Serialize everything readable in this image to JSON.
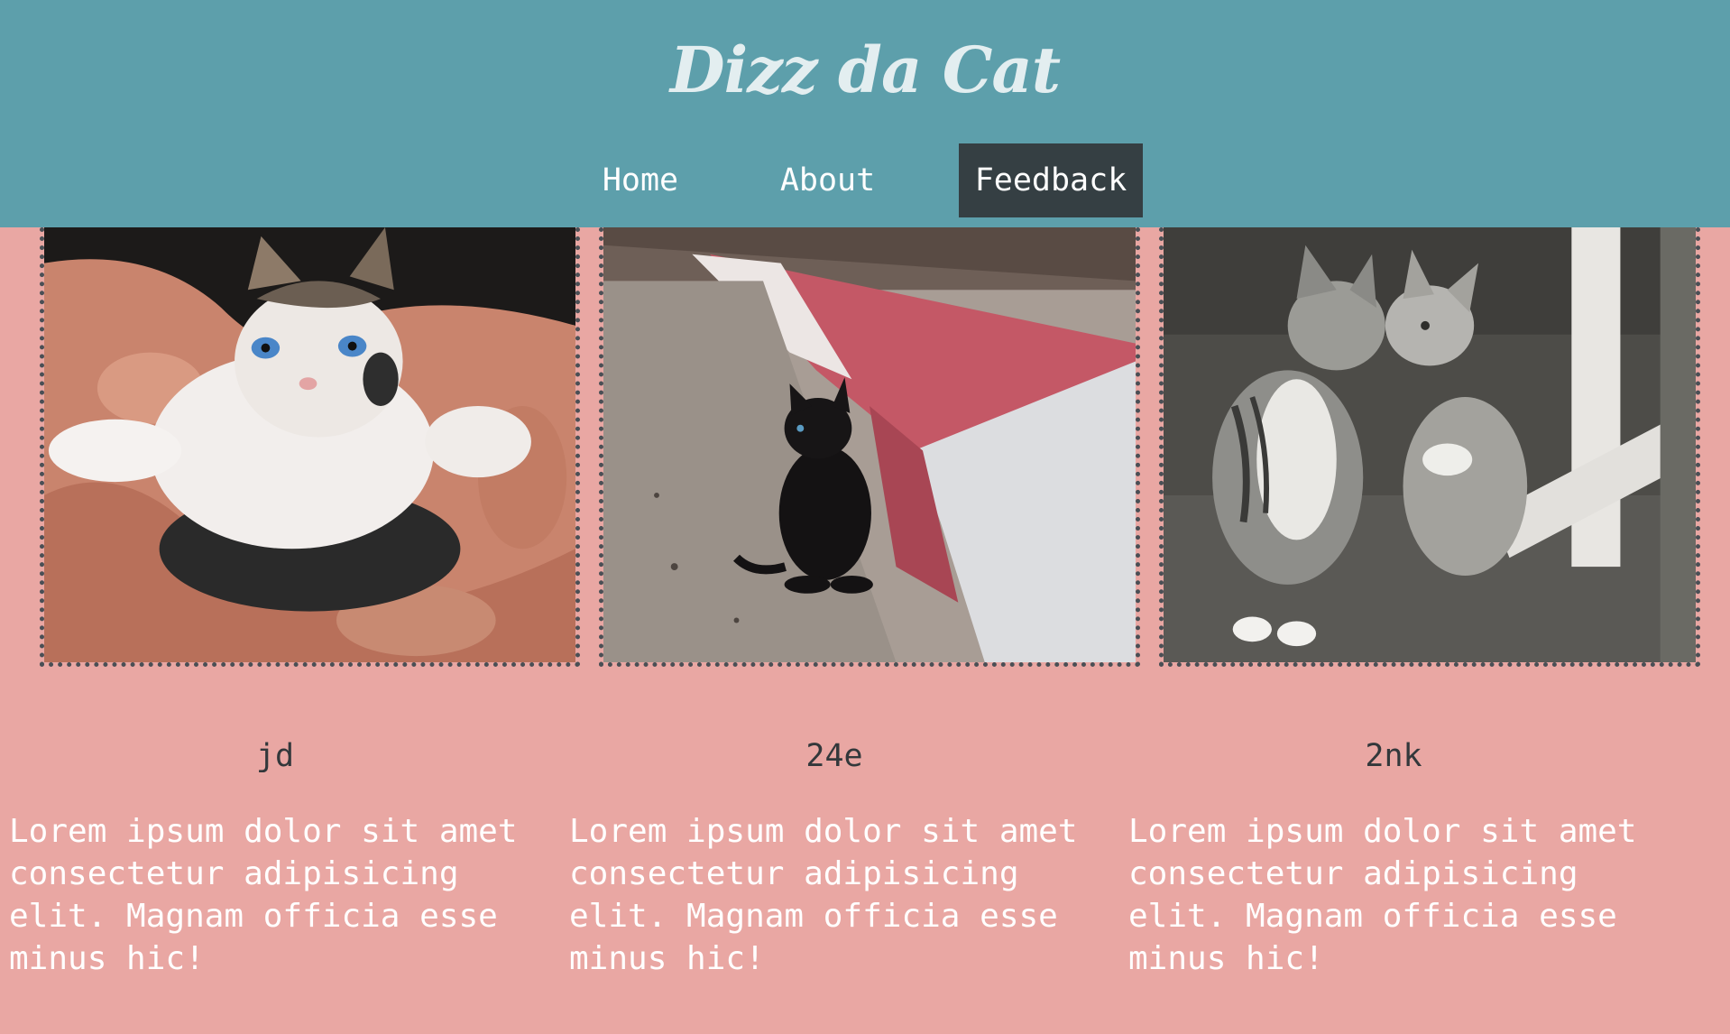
{
  "header": {
    "title": "Dizz da Cat",
    "nav": [
      {
        "label": "Home"
      },
      {
        "label": "About"
      },
      {
        "label": "Feedback",
        "active": true
      }
    ]
  },
  "cards": [
    {
      "caption": "jd",
      "text": "Lorem ipsum dolor sit amet consectetur adipisicing elit. Magnam officia esse minus hic!"
    },
    {
      "caption": "24e",
      "text": "Lorem ipsum dolor sit amet consectetur adipisicing elit. Magnam officia esse minus hic!"
    },
    {
      "caption": "2nk",
      "text": "Lorem ipsum dolor sit amet consectetur adipisicing elit. Magnam officia esse minus hic!"
    }
  ],
  "colors": {
    "header_bg": "#5d9fab",
    "page_bg": "#e9a7a3",
    "active_nav_bg": "#353f43"
  }
}
